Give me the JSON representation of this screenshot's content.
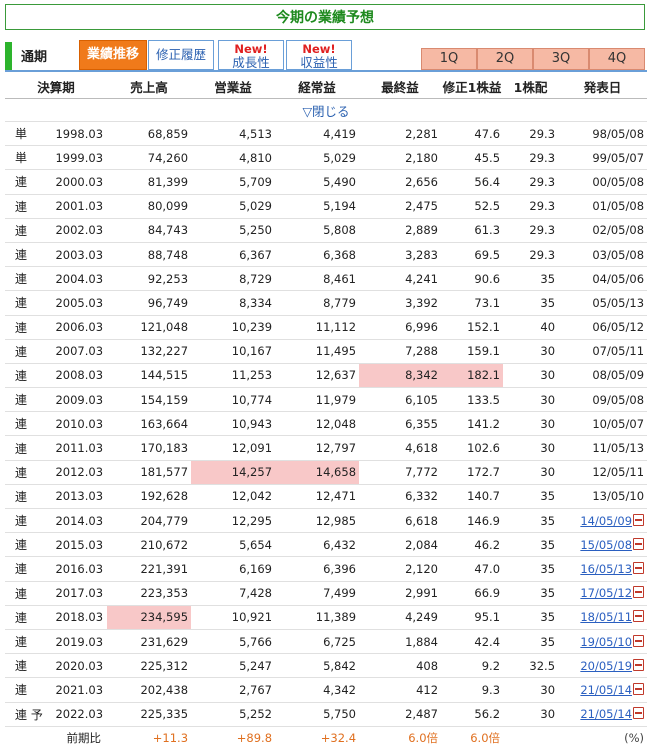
{
  "title": "今期の業績予想",
  "tabs": {
    "plain": "通期",
    "active": "業績推移",
    "revision": "修正履歴",
    "growth_new": "New!",
    "growth": "成長性",
    "profit_new": "New!",
    "profit": "収益性"
  },
  "quarters": [
    "1Q",
    "2Q",
    "3Q",
    "4Q"
  ],
  "headers": [
    "決算期",
    "売上高",
    "営業益",
    "経常益",
    "最終益",
    "修正1株益",
    "1株配",
    "発表日"
  ],
  "toggle": "▽閉じる",
  "rows": [
    {
      "k": "単",
      "p": "1998.03",
      "s": "68,859",
      "o": "4,513",
      "r": "4,419",
      "n": "2,281",
      "e": "47.6",
      "d": "29.3",
      "date": "98/05/08",
      "link": false
    },
    {
      "k": "単",
      "p": "1999.03",
      "s": "74,260",
      "o": "4,810",
      "r": "5,029",
      "n": "2,180",
      "e": "45.5",
      "d": "29.3",
      "date": "99/05/07",
      "link": false
    },
    {
      "k": "連",
      "p": "2000.03",
      "s": "81,399",
      "o": "5,709",
      "r": "5,490",
      "n": "2,656",
      "e": "56.4",
      "d": "29.3",
      "date": "00/05/08",
      "link": false
    },
    {
      "k": "連",
      "p": "2001.03",
      "s": "80,099",
      "o": "5,029",
      "r": "5,194",
      "n": "2,475",
      "e": "52.5",
      "d": "29.3",
      "date": "01/05/08",
      "link": false
    },
    {
      "k": "連",
      "p": "2002.03",
      "s": "84,743",
      "o": "5,250",
      "r": "5,808",
      "n": "2,889",
      "e": "61.3",
      "d": "29.3",
      "date": "02/05/08",
      "link": false
    },
    {
      "k": "連",
      "p": "2003.03",
      "s": "88,748",
      "o": "6,367",
      "r": "6,368",
      "n": "3,283",
      "e": "69.5",
      "d": "29.3",
      "date": "03/05/08",
      "link": false
    },
    {
      "k": "連",
      "p": "2004.03",
      "s": "92,253",
      "o": "8,729",
      "r": "8,461",
      "n": "4,241",
      "e": "90.6",
      "d": "35",
      "date": "04/05/06",
      "link": false
    },
    {
      "k": "連",
      "p": "2005.03",
      "s": "96,749",
      "o": "8,334",
      "r": "8,779",
      "n": "3,392",
      "e": "73.1",
      "d": "35",
      "date": "05/05/13",
      "link": false
    },
    {
      "k": "連",
      "p": "2006.03",
      "s": "121,048",
      "o": "10,239",
      "r": "11,112",
      "n": "6,996",
      "e": "152.1",
      "d": "40",
      "date": "06/05/12",
      "link": false
    },
    {
      "k": "連",
      "p": "2007.03",
      "s": "132,227",
      "o": "10,167",
      "r": "11,495",
      "n": "7,288",
      "e": "159.1",
      "d": "30",
      "date": "07/05/11",
      "link": false
    },
    {
      "k": "連",
      "p": "2008.03",
      "s": "144,515",
      "o": "11,253",
      "r": "12,637",
      "n": "8,342",
      "e": "182.1",
      "d": "30",
      "date": "08/05/09",
      "link": false,
      "hl": [
        "n",
        "e"
      ]
    },
    {
      "k": "連",
      "p": "2009.03",
      "s": "154,159",
      "o": "10,774",
      "r": "11,979",
      "n": "6,105",
      "e": "133.5",
      "d": "30",
      "date": "09/05/08",
      "link": false
    },
    {
      "k": "連",
      "p": "2010.03",
      "s": "163,664",
      "o": "10,943",
      "r": "12,048",
      "n": "6,355",
      "e": "141.2",
      "d": "30",
      "date": "10/05/07",
      "link": false
    },
    {
      "k": "連",
      "p": "2011.03",
      "s": "170,183",
      "o": "12,091",
      "r": "12,797",
      "n": "4,618",
      "e": "102.6",
      "d": "30",
      "date": "11/05/13",
      "link": false
    },
    {
      "k": "連",
      "p": "2012.03",
      "s": "181,577",
      "o": "14,257",
      "r": "14,658",
      "n": "7,772",
      "e": "172.7",
      "d": "30",
      "date": "12/05/11",
      "link": false,
      "hl": [
        "o",
        "r"
      ]
    },
    {
      "k": "連",
      "p": "2013.03",
      "s": "192,628",
      "o": "12,042",
      "r": "12,471",
      "n": "6,332",
      "e": "140.7",
      "d": "35",
      "date": "13/05/10",
      "link": false
    },
    {
      "k": "連",
      "p": "2014.03",
      "s": "204,779",
      "o": "12,295",
      "r": "12,985",
      "n": "6,618",
      "e": "146.9",
      "d": "35",
      "date": "14/05/09",
      "link": true
    },
    {
      "k": "連",
      "p": "2015.03",
      "s": "210,672",
      "o": "5,654",
      "r": "6,432",
      "n": "2,084",
      "e": "46.2",
      "d": "35",
      "date": "15/05/08",
      "link": true
    },
    {
      "k": "連",
      "p": "2016.03",
      "s": "221,391",
      "o": "6,169",
      "r": "6,396",
      "n": "2,120",
      "e": "47.0",
      "d": "35",
      "date": "16/05/13",
      "link": true
    },
    {
      "k": "連",
      "p": "2017.03",
      "s": "223,353",
      "o": "7,428",
      "r": "7,499",
      "n": "2,991",
      "e": "66.9",
      "d": "35",
      "date": "17/05/12",
      "link": true
    },
    {
      "k": "連",
      "p": "2018.03",
      "s": "234,595",
      "o": "10,921",
      "r": "11,389",
      "n": "4,249",
      "e": "95.1",
      "d": "35",
      "date": "18/05/11",
      "link": true,
      "hl": [
        "s"
      ]
    },
    {
      "k": "連",
      "p": "2019.03",
      "s": "231,629",
      "o": "5,766",
      "r": "6,725",
      "n": "1,884",
      "e": "42.4",
      "d": "35",
      "date": "19/05/10",
      "link": true
    },
    {
      "k": "連",
      "p": "2020.03",
      "s": "225,312",
      "o": "5,247",
      "r": "5,842",
      "n": "408",
      "e": "9.2",
      "d": "32.5",
      "date": "20/05/19",
      "link": true
    },
    {
      "k": "連",
      "p": "2021.03",
      "s": "202,438",
      "o": "2,767",
      "r": "4,342",
      "n": "412",
      "e": "9.3",
      "d": "30",
      "date": "21/05/14",
      "link": true
    },
    {
      "k": "連 予",
      "p": "2022.03",
      "s": "225,335",
      "o": "5,252",
      "r": "5,750",
      "n": "2,487",
      "e": "56.2",
      "d": "30",
      "date": "21/05/14",
      "link": true
    }
  ],
  "summary": {
    "label": "前期比",
    "s": "+11.3",
    "o": "+89.8",
    "r": "+32.4",
    "n": "6.0倍",
    "e": "6.0倍",
    "unit": "(%)"
  }
}
